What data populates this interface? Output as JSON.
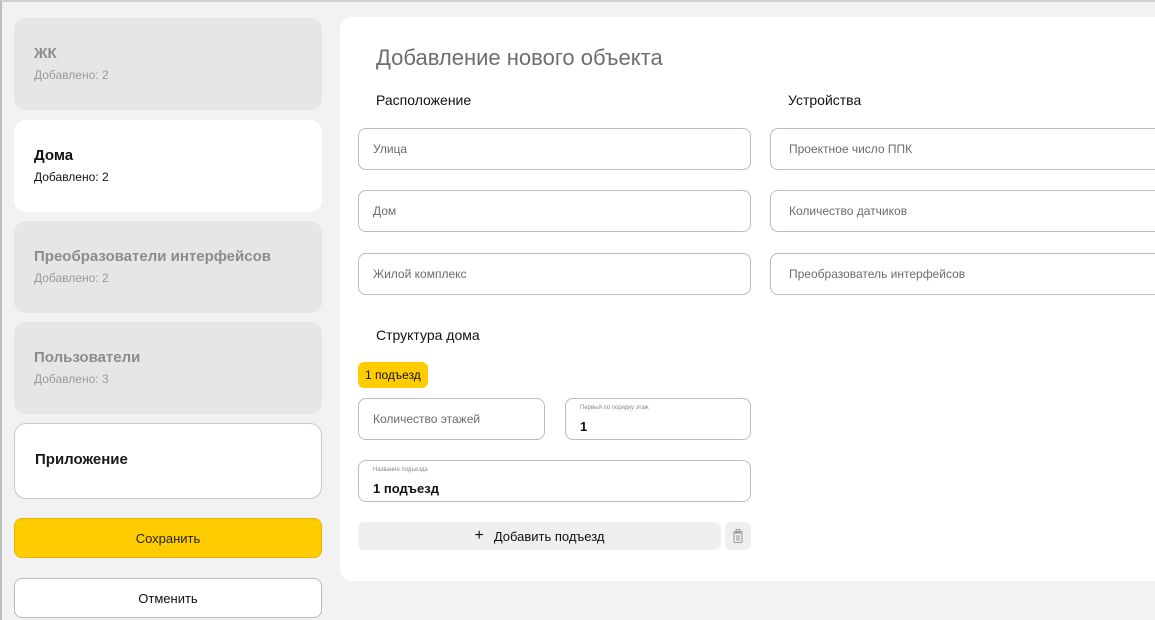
{
  "sidebar": {
    "items": [
      {
        "title": "ЖК",
        "subtitle": "Добавлено: 2"
      },
      {
        "title": "Дома",
        "subtitle": "Добавлено: 2"
      },
      {
        "title": "Преобразователи интерфейсов",
        "subtitle": "Добавлено: 2"
      },
      {
        "title": "Пользователи",
        "subtitle": "Добавлено: 3"
      },
      {
        "title": "Приложение"
      }
    ],
    "save_label": "Сохранить",
    "cancel_label": "Отменить"
  },
  "form": {
    "title": "Добавление нового объекта",
    "location": {
      "heading": "Расположение",
      "street_placeholder": "Улица",
      "house_placeholder": "Дом",
      "complex_placeholder": "Жилой комплекс"
    },
    "devices": {
      "heading": "Устройства",
      "ppk_placeholder": "Проектное число ППК",
      "sensors_placeholder": "Количество датчиков",
      "converter_placeholder": "Преобразователь интерфейсов"
    },
    "structure": {
      "heading": "Структура дома",
      "entrance_chip": "1 подъезд",
      "floors_placeholder": "Количество этажей",
      "first_floor_label": "Первый по порядку этаж",
      "first_floor_value": "1",
      "entrance_name_label": "Название подъезда",
      "entrance_name_value": "1 подъезд",
      "add_entrance_label": "Добавить подъезд",
      "add_icon": "plus-icon",
      "delete_icon": "trash-icon"
    }
  },
  "colors": {
    "accent": "#ffcc00",
    "background": "#f2f2f2",
    "card_gray": "#e6e6e6"
  }
}
